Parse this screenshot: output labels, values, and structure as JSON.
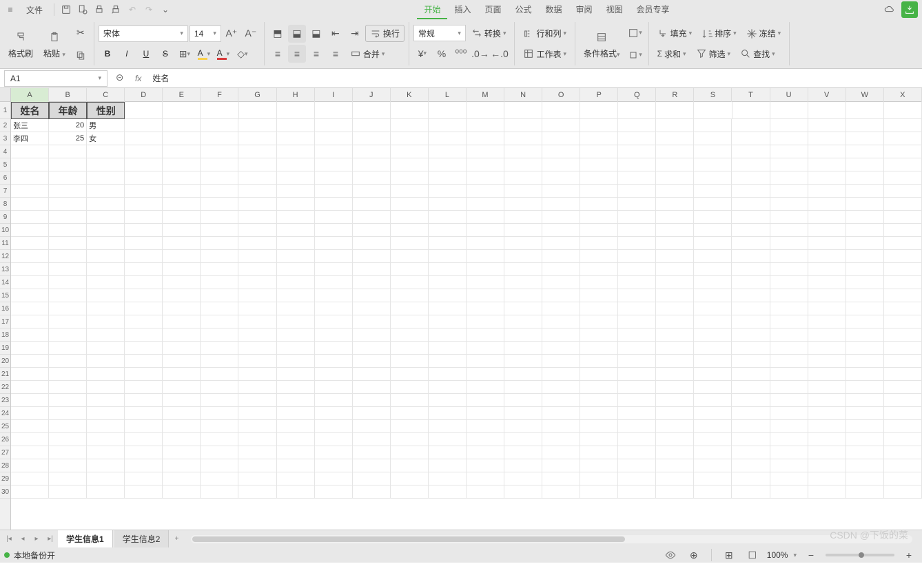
{
  "menu": {
    "file": "文件",
    "items": [
      "开始",
      "插入",
      "页面",
      "公式",
      "数据",
      "审阅",
      "视图",
      "会员专享"
    ]
  },
  "ribbon": {
    "formatPainter": "格式刷",
    "paste": "粘贴",
    "font": "宋体",
    "size": "14",
    "numberFormat": "常规",
    "convert": "转换",
    "wrap": "换行",
    "merge": "合并",
    "rowsCols": "行和列",
    "worksheet": "工作表",
    "condFormat": "条件格式",
    "fill": "填充",
    "sort": "排序",
    "freeze": "冻结",
    "sum": "求和",
    "filter": "筛选",
    "find": "查找"
  },
  "formula": {
    "nameBox": "A1",
    "value": "姓名"
  },
  "columns": [
    "A",
    "B",
    "C",
    "D",
    "E",
    "F",
    "G",
    "H",
    "I",
    "J",
    "K",
    "L",
    "M",
    "N",
    "O",
    "P",
    "Q",
    "R",
    "S",
    "T",
    "U",
    "V",
    "W",
    "X"
  ],
  "headers": [
    "姓名",
    "年龄",
    "性别"
  ],
  "data": [
    [
      "张三",
      "20",
      "男"
    ],
    [
      "李四",
      "25",
      "女"
    ]
  ],
  "sheets": [
    "学生信息1",
    "学生信息2"
  ],
  "status": {
    "backup": "本地备份开",
    "zoom": "100%"
  },
  "watermark": "CSDN @下饭的菜"
}
